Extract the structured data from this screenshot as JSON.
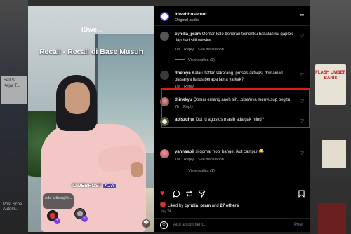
{
  "background": {
    "left_sign_text": "Sell Si Kejar T...",
    "left_bottom_text": "Post Sche Autom...",
    "right_sign_text": "FLASH UMBER BARIS"
  },
  "video": {
    "logo": "IDwe...",
    "title": "Recall - Recall di Base Musuh",
    "brand": "IDWEBHOST",
    "brand_tag": "AJA",
    "note_text": "Add a thought...",
    "mute_icon": "speaker-mute-icon"
  },
  "header": {
    "account": "idwebhostcom",
    "audio": "Original audio",
    "more_icon": "ellipsis-icon"
  },
  "comments": [
    {
      "user": "cyndia_pram",
      "text": "Qomar kalo beneran temenku bakalan ku gaplok tiap hari siiii wkwkw",
      "age": "1w",
      "reply": "Reply",
      "translate": "See translation",
      "view_replies": "View replies (3)"
    },
    {
      "user": "dheteye",
      "text": "Kalau daftar sekarang, proses aktivasi domain id biasanya harus berapa lama ya kak?",
      "age": "1w",
      "reply": "Reply",
      "view_replies": "View replies (1)"
    },
    {
      "user": "thinkkyu",
      "text": "Qomar emang aneh sih...bisa²nya menyusup begitu",
      "age": "7h",
      "reply": "Reply"
    },
    {
      "user": "abiszuhur",
      "text": "Dot id agustus masih ada gak mind?"
    },
    {
      "user": "yannaabii",
      "text": "si qomar hobi banget ikut campur 😂",
      "age": "1w",
      "reply": "Reply",
      "translate": "See translation",
      "view_replies": "View replies (1)"
    }
  ],
  "engagement": {
    "liked_by_prefix": "Liked by",
    "liked_by_user": "cyndia_pram",
    "liked_by_and": "and",
    "liked_by_others": "27 others",
    "date": "July 24"
  },
  "composer": {
    "placeholder": "Add a comment...",
    "post_label": "Post"
  },
  "colors": {
    "highlight": "#e01b1b",
    "liked_heart": "#ed2b3a",
    "brand_purple": "#5a4fd8"
  }
}
